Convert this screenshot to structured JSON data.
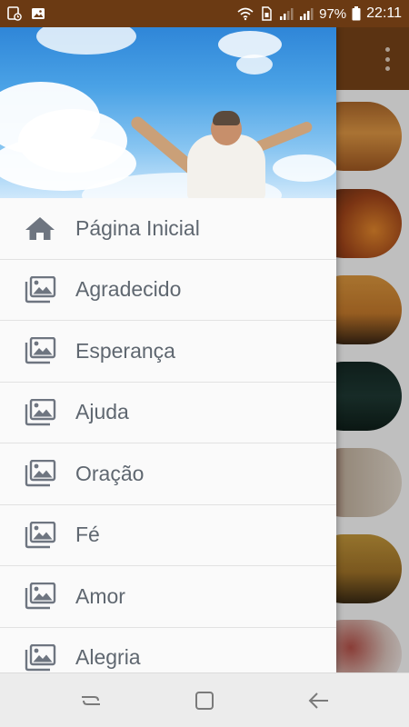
{
  "status_bar": {
    "left_icons": [
      "notification-icon",
      "image-icon"
    ],
    "right_icons": [
      "wifi-icon",
      "sim-icon",
      "signal-icon",
      "signal-icon-2",
      "battery-icon"
    ],
    "battery": "97%",
    "time": "22:11",
    "background_color": "#6b3a13"
  },
  "app": {
    "toolbar_color": "#7a4418",
    "overflow_icon": "more-vert-icon"
  },
  "drawer": {
    "header_image": "man-arms-raised-sky",
    "menu": [
      {
        "label": "Página Inicial",
        "icon": "home-icon"
      },
      {
        "label": "Agradecido",
        "icon": "gallery-icon"
      },
      {
        "label": "Esperança",
        "icon": "gallery-icon"
      },
      {
        "label": "Ajuda",
        "icon": "gallery-icon"
      },
      {
        "label": "Oração",
        "icon": "gallery-icon"
      },
      {
        "label": "Fé",
        "icon": "gallery-icon"
      },
      {
        "label": "Amor",
        "icon": "gallery-icon"
      },
      {
        "label": "Alegria",
        "icon": "gallery-icon"
      }
    ],
    "icon_color": "#6e7580",
    "text_color": "#5f6770"
  },
  "nav_bar": {
    "buttons": [
      "recent-apps-icon",
      "home-button-icon",
      "back-icon"
    ]
  }
}
